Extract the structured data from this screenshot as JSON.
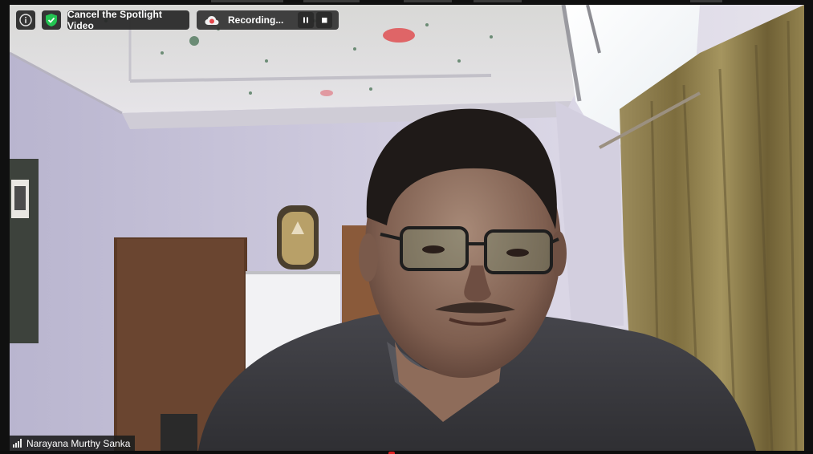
{
  "toolbar": {
    "info_icon": "info-icon",
    "shield_icon": "shield-check-icon",
    "shield_color": "#23c552",
    "spotlight_label": "Cancel the Spotlight Video"
  },
  "recording": {
    "label": "Recording...",
    "icon": "cloud-record-icon",
    "icon_color": "#e5484d",
    "pause_icon": "pause-icon",
    "stop_icon": "stop-icon"
  },
  "participant": {
    "name": "Narayana Murthy Sanka",
    "signal_icon": "signal-bars-icon"
  },
  "video": {
    "description_colors": {
      "wall": "#c9c4d4",
      "ceiling": "#dcdada",
      "door": "#5e3a24",
      "curtain": "#8a7a4a",
      "shirt": "#3c3c40"
    }
  }
}
